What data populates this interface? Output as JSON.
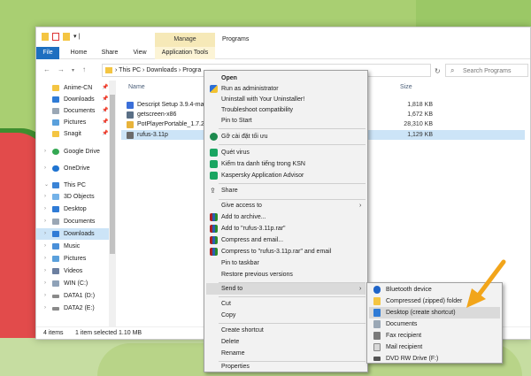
{
  "window": {
    "manage_tab": "Manage",
    "title": "Programs",
    "qat_label": "▾ |"
  },
  "ribbon": {
    "file": "File",
    "home": "Home",
    "share": "Share",
    "view": "View",
    "app_tools": "Application Tools"
  },
  "address": {
    "path_this_pc": "This PC",
    "path_downloads": "Downloads",
    "path_programs": "Progra",
    "search_placeholder": "Search Programs"
  },
  "nav": {
    "items": [
      {
        "label": "Anime-CN",
        "pinned": true
      },
      {
        "label": "Downloads",
        "pinned": true
      },
      {
        "label": "Documents",
        "pinned": true
      },
      {
        "label": "Pictures",
        "pinned": true
      },
      {
        "label": "Snagit",
        "pinned": true
      },
      {
        "label": "Google Drive"
      },
      {
        "label": "OneDrive"
      },
      {
        "label": "This PC"
      },
      {
        "label": "3D Objects"
      },
      {
        "label": "Desktop"
      },
      {
        "label": "Documents"
      },
      {
        "label": "Downloads"
      },
      {
        "label": "Music"
      },
      {
        "label": "Pictures"
      },
      {
        "label": "Videos"
      },
      {
        "label": "WIN (C:)"
      },
      {
        "label": "DATA1 (D:)"
      },
      {
        "label": "DATA2 (E:)"
      }
    ],
    "pin_glyph": "📌"
  },
  "filelist": {
    "col_name": "Name",
    "col_size": "Size",
    "files": [
      {
        "name": "Descript Setup 3.9.4-ma",
        "size": "1,818 KB"
      },
      {
        "name": "getscreen-x86",
        "size": "1,672 KB"
      },
      {
        "name": "PotPlayerPortable_1.7.2",
        "size": "28,310 KB"
      },
      {
        "name": "rufus-3.11p",
        "size": "1,129 KB"
      }
    ]
  },
  "status": {
    "items": "4 items",
    "selected": "1 item selected  1.10 MB"
  },
  "context_menu": {
    "items": [
      "Open",
      "Run as administrator",
      "Uninstall with Your Uninstaller!",
      "Troubleshoot compatibility",
      "Pin to Start",
      "Gỡ cài đặt tối ưu",
      "Quét virus",
      "Kiểm tra danh tiếng trong KSN",
      "Kaspersky Application Advisor",
      "Share",
      "Give access to",
      "Add to archive...",
      "Add to \"rufus-3.11p.rar\"",
      "Compress and email...",
      "Compress to \"rufus-3.11p.rar\" and email",
      "Pin to taskbar",
      "Restore previous versions",
      "Send to",
      "Cut",
      "Copy",
      "Create shortcut",
      "Delete",
      "Rename",
      "Properties"
    ],
    "submenu_arrow": "›"
  },
  "send_to": {
    "items": [
      "Bluetooth device",
      "Compressed (zipped) folder",
      "Desktop (create shortcut)",
      "Documents",
      "Fax recipient",
      "Mail recipient",
      "DVD RW Drive (F:)"
    ]
  },
  "colors": {
    "accent": "#1e6fc0",
    "selection": "#cce4f7",
    "menu_bg": "#f2f2f2",
    "annotation_arrow": "#f2a51a"
  }
}
